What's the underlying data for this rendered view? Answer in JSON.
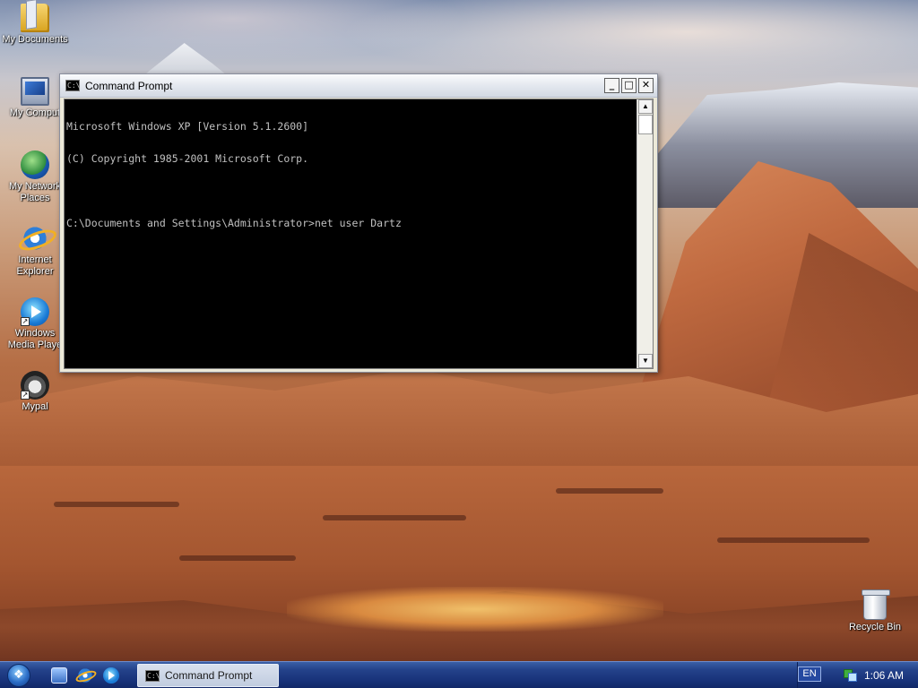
{
  "desktop": {
    "icons": [
      {
        "label": "My Documents",
        "icon": "folder-icon"
      },
      {
        "label": "My Comput",
        "icon": "computer-icon"
      },
      {
        "label": "My Network Places",
        "icon": "network-places-icon"
      },
      {
        "label": "Internet Explorer",
        "icon": "internet-explorer-icon"
      },
      {
        "label": "Windows Media Playe",
        "icon": "media-player-icon"
      },
      {
        "label": "Mypal",
        "icon": "mypal-icon"
      },
      {
        "label": "Recycle Bin",
        "icon": "recycle-bin-icon"
      }
    ]
  },
  "window": {
    "title": "Command Prompt",
    "buttons": {
      "minimize": "_",
      "maximize": "□",
      "close": "✕"
    },
    "console_lines": [
      "Microsoft Windows XP [Version 5.1.2600]",
      "(C) Copyright 1985-2001 Microsoft Corp.",
      "",
      "C:\\Documents and Settings\\Administrator>net user Dartz"
    ],
    "scroll_up": "▲",
    "scroll_down": "▼"
  },
  "taskbar": {
    "task_label": "Command Prompt",
    "language": "EN",
    "clock": "1:06 AM",
    "cmd_icon_text": "C:\\"
  },
  "colors": {
    "console_bg": "#000000",
    "console_fg": "#c0c0c0",
    "taskbar": "#18337a"
  }
}
